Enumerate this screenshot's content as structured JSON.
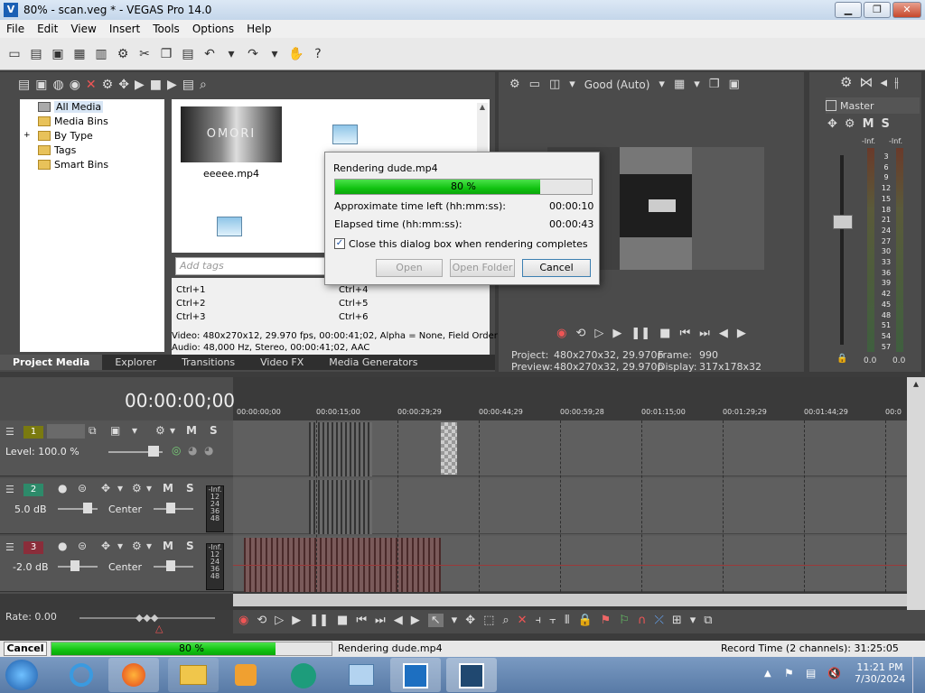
{
  "window": {
    "title": "80% - scan.veg * - VEGAS Pro 14.0",
    "min": "▁",
    "max": "❐",
    "close": "✕"
  },
  "menu": [
    "File",
    "Edit",
    "View",
    "Insert",
    "Tools",
    "Options",
    "Help"
  ],
  "project_media": {
    "tree": [
      "All Media",
      "Media Bins",
      "By Type",
      "Tags",
      "Smart Bins"
    ],
    "file_name": "eeeee.mp4",
    "thumb_text": "OMORI",
    "tags_placeholder": "Add tags",
    "shortcuts": [
      "Ctrl+1",
      "Ctrl+2",
      "Ctrl+3",
      "Ctrl+4",
      "Ctrl+5",
      "Ctrl+6"
    ],
    "video_info": "Video: 480x270x12, 29.970 fps, 00:00:41;02, Alpha = None, Field Order",
    "audio_info": "Audio: 48,000 Hz, Stereo, 00:00:41;02, AAC"
  },
  "tabs": [
    "Project Media",
    "Explorer",
    "Transitions",
    "Video FX",
    "Media Generators"
  ],
  "preview": {
    "quality": "Good (Auto)",
    "project_label": "Project:",
    "project_val": "480x270x32, 29.970p",
    "preview_label": "Preview:",
    "preview_val": "480x270x32, 29.970p",
    "frame_label": "Frame:",
    "frame_val": "990",
    "display_label": "Display:",
    "display_val": "317x178x32"
  },
  "master": {
    "label": "Master",
    "m": "M",
    "s": "S",
    "inf1": "-Inf.",
    "inf2": "-Inf.",
    "scale": [
      "3",
      "6",
      "9",
      "12",
      "15",
      "18",
      "21",
      "24",
      "27",
      "30",
      "33",
      "36",
      "39",
      "42",
      "45",
      "48",
      "51",
      "54",
      "57"
    ],
    "val1": "0.0",
    "val2": "0.0"
  },
  "dialog": {
    "title": "Rendering dude.mp4",
    "progress_label": "80 %",
    "progress": 0.8,
    "time_left_label": "Approximate time left (hh:mm:ss):",
    "time_left": "00:00:10",
    "elapsed_label": "Elapsed time (hh:mm:ss):",
    "elapsed": "00:00:43",
    "close_option": "Close this dialog box when rendering completes",
    "open": "Open",
    "open_folder": "Open Folder",
    "cancel": "Cancel"
  },
  "timeline": {
    "timecode": "00:00:00;00",
    "ruler": [
      "00:00:00;00",
      "00:00:15;00",
      "00:00:29;29",
      "00:00:44;29",
      "00:00:59;28",
      "00:01:15;00",
      "00:01:29;29",
      "00:01:44;29",
      "00:0"
    ],
    "tracks": [
      {
        "num": "1",
        "level": "Level: 100.0 %",
        "color": "#7a7a10"
      },
      {
        "num": "2",
        "level": "5.0 dB",
        "pan": "Center",
        "color": "#2d8a6a"
      },
      {
        "num": "3",
        "level": "-2.0 dB",
        "pan": "Center",
        "color": "#8a2d3a"
      }
    ],
    "meter_inf": "-Inf.",
    "meter_scale": [
      "12",
      "24",
      "36",
      "48"
    ],
    "m": "M",
    "s": "S",
    "rate": "Rate: 0.00"
  },
  "status": {
    "cancel": "Cancel",
    "progress_label": "80 %",
    "progress": 0.8,
    "rendering": "Rendering dude.mp4",
    "record_time": "Record Time (2 channels): 31:25:05"
  },
  "taskbar": {
    "time": "11:21 PM",
    "date": "7/30/2024"
  }
}
